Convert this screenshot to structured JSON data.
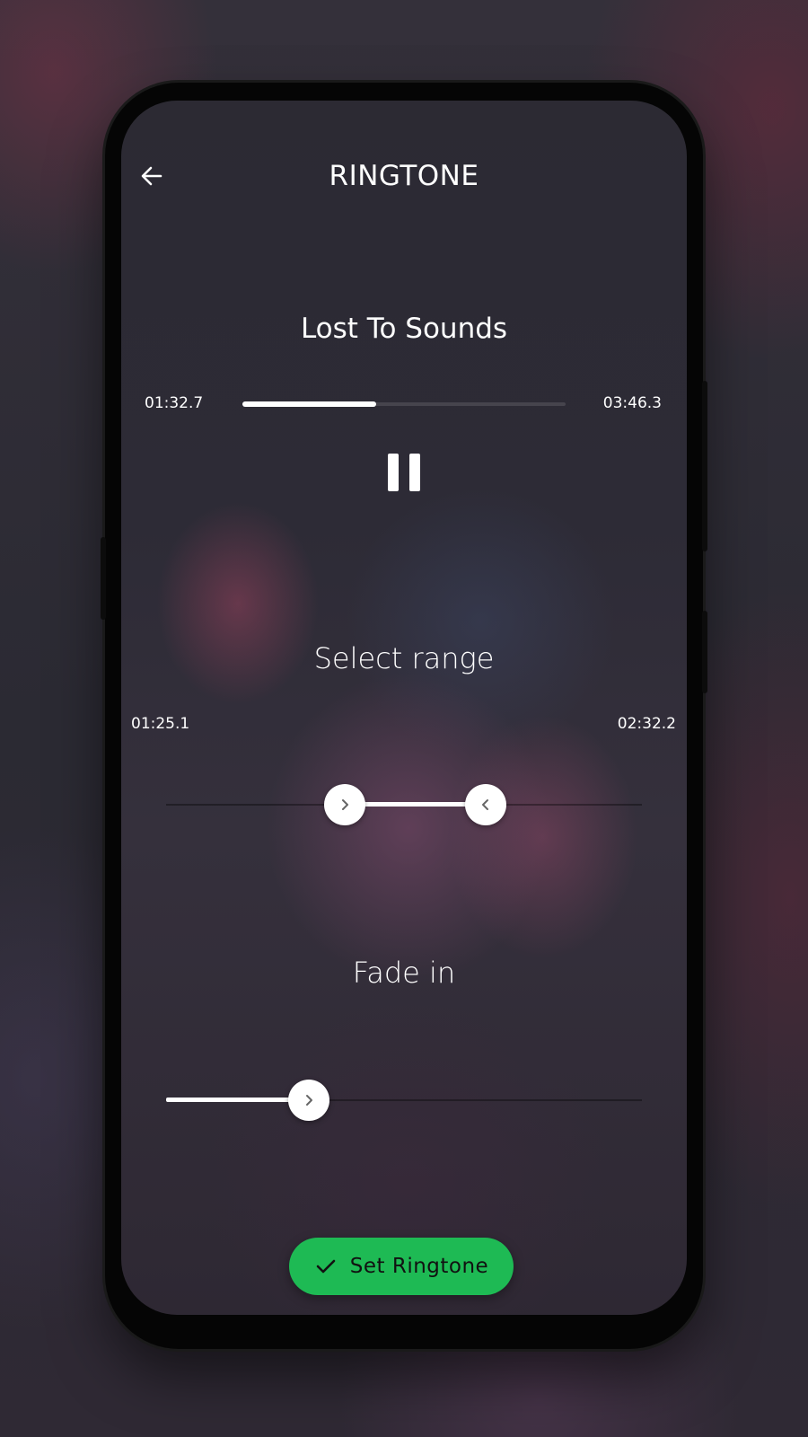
{
  "header": {
    "title": "RINGTONE",
    "back_icon": "arrow-left-icon"
  },
  "player": {
    "song_title": "Lost To Sounds",
    "elapsed": "01:32.7",
    "duration": "03:46.3",
    "progress_fraction": 0.415,
    "control_icon": "pause-icon"
  },
  "range": {
    "label": "Select range",
    "start": "01:25.1",
    "end": "02:32.2",
    "start_fraction": 0.375,
    "end_fraction": 0.672
  },
  "fade_in": {
    "label": "Fade in",
    "fraction": 0.3
  },
  "action": {
    "label": "Set Ringtone",
    "icon": "check-icon"
  },
  "colors": {
    "accent": "#1eba54",
    "text": "#ffffff"
  }
}
